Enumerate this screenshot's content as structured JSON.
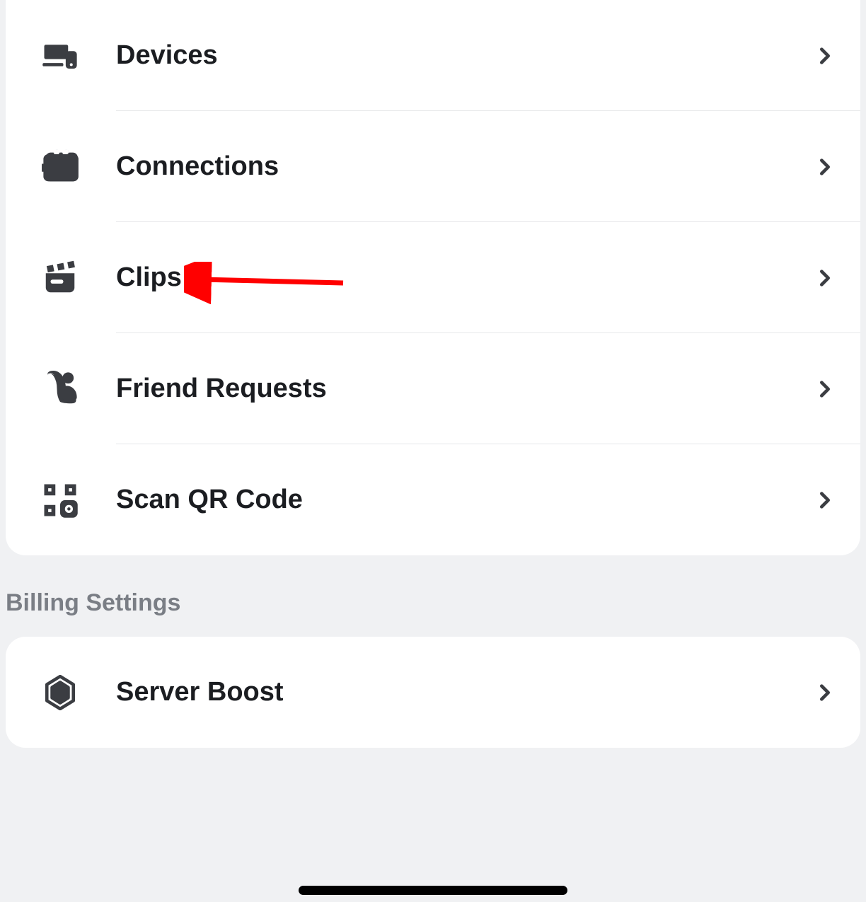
{
  "settings": {
    "items": [
      {
        "id": "devices",
        "label": "Devices",
        "icon": "devices-icon"
      },
      {
        "id": "connections",
        "label": "Connections",
        "icon": "plug-icon"
      },
      {
        "id": "clips",
        "label": "Clips",
        "icon": "clapperboard-icon"
      },
      {
        "id": "friend-requests",
        "label": "Friend Requests",
        "icon": "wave-icon"
      },
      {
        "id": "scan-qr",
        "label": "Scan QR Code",
        "icon": "qr-icon"
      }
    ]
  },
  "billing": {
    "header": "Billing Settings",
    "items": [
      {
        "id": "server-boost",
        "label": "Server Boost",
        "icon": "boost-icon"
      }
    ]
  },
  "annotation": {
    "target": "clips",
    "color": "#ff0000"
  }
}
